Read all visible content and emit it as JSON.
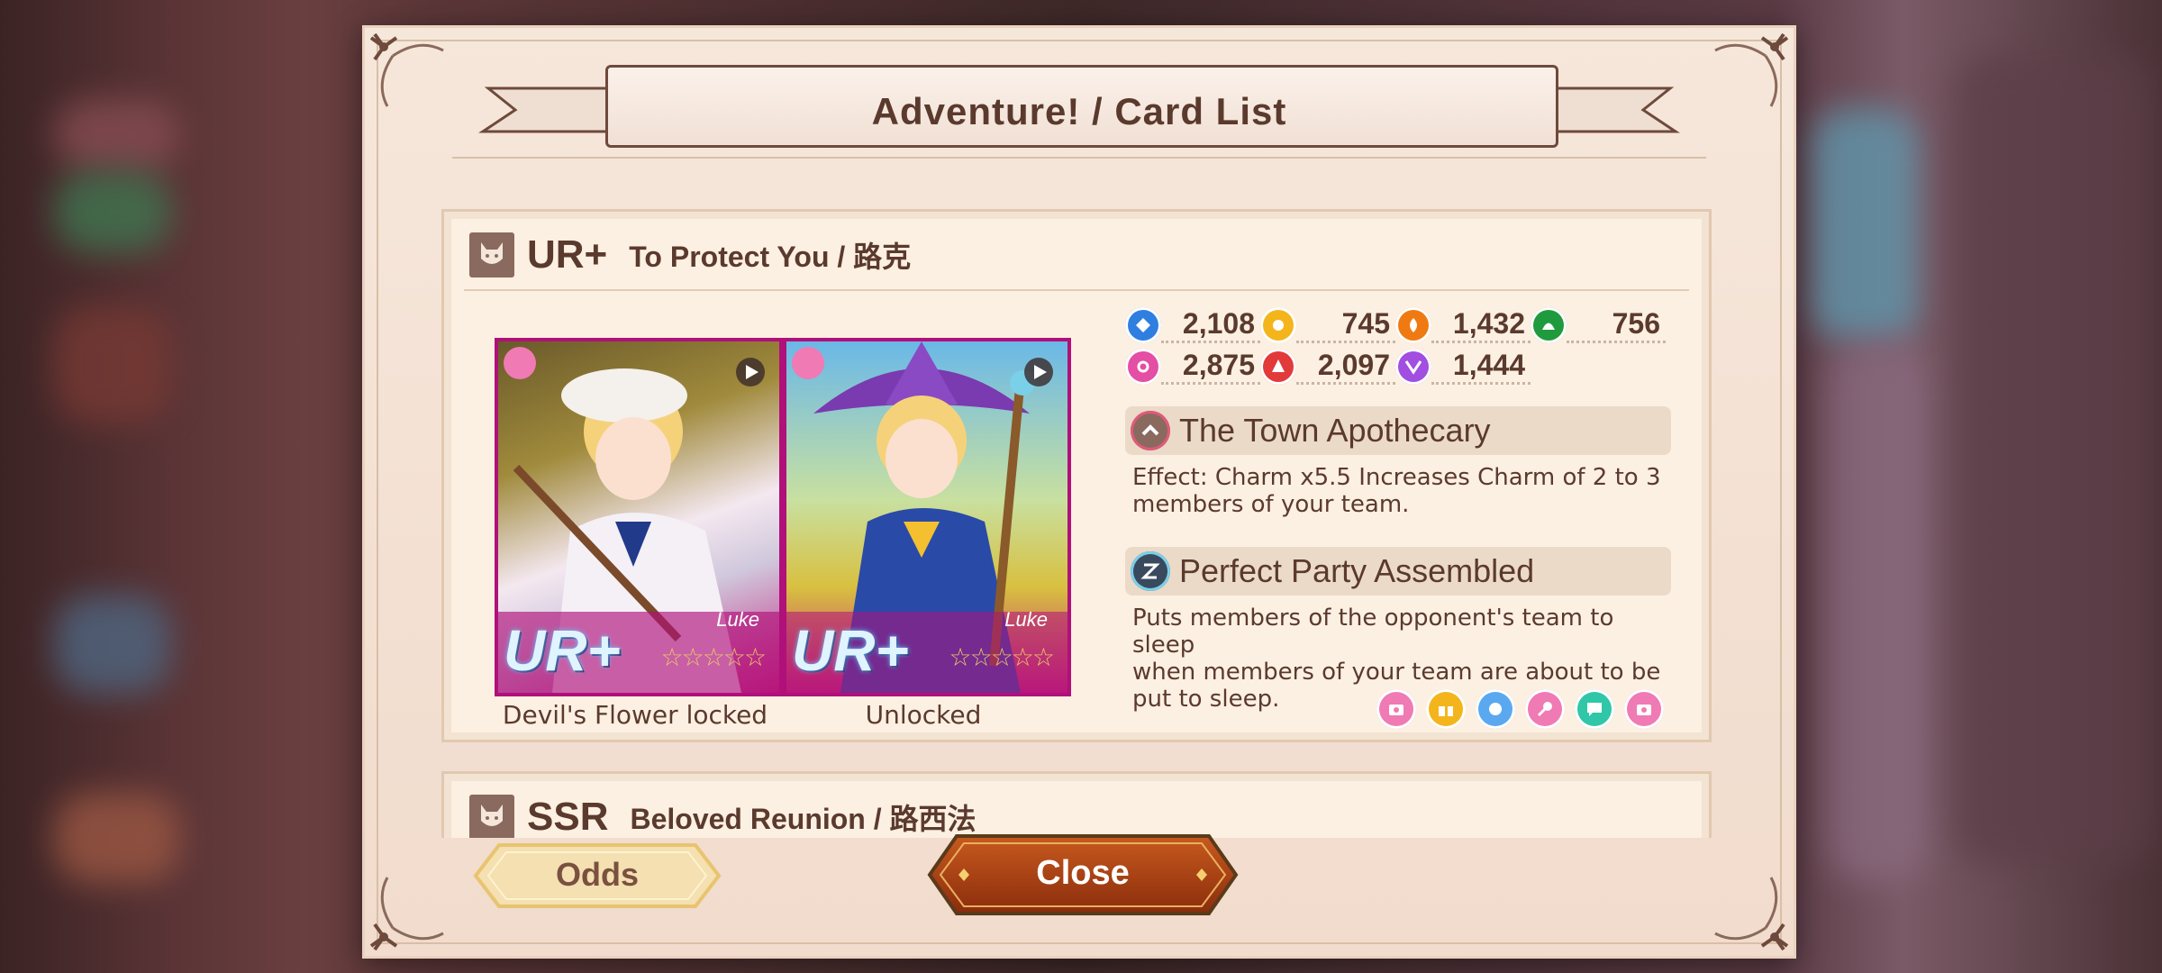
{
  "dialog": {
    "title": "Adventure! / Card List"
  },
  "cards": [
    {
      "rarity": "UR+",
      "name": "To Protect You / 路克",
      "images": [
        {
          "badge": "UR+",
          "character": "Luke",
          "caption": "Devil's Flower locked"
        },
        {
          "badge": "UR+",
          "character": "Luke",
          "caption": "Unlocked"
        }
      ],
      "stats": {
        "row1": [
          {
            "icon": "blue-diamond-icon",
            "color": "#2f7fe0",
            "value": "2,108"
          },
          {
            "icon": "yellow-sun-icon",
            "color": "#f4b51c",
            "value": "745"
          },
          {
            "icon": "orange-flame-icon",
            "color": "#f07a12",
            "value": "1,432"
          },
          {
            "icon": "green-leaf-icon",
            "color": "#1f9b3e",
            "value": "756"
          }
        ],
        "row2": [
          {
            "icon": "pink-crest-icon",
            "color": "#e44ea4",
            "value": "2,875"
          },
          {
            "icon": "red-crest-icon",
            "color": "#e23a3a",
            "value": "2,097"
          },
          {
            "icon": "purple-wing-icon",
            "color": "#a24ee0",
            "value": "1,444"
          }
        ]
      },
      "skills": [
        {
          "icon": "chevron-up-icon",
          "title": "The Town Apothecary",
          "desc1": "Effect: Charm x5.5 Increases Charm of 2 to 3",
          "desc2": "members of your team."
        },
        {
          "icon": "sleep-z-icon",
          "title": "Perfect Party Assembled",
          "desc1": "Puts members of the opponent's team to sleep",
          "desc2": "when members of your team are about to be",
          "desc3": "put to sleep."
        }
      ],
      "tag_icons": [
        {
          "icon": "camera-icon",
          "color": "#f07ab4"
        },
        {
          "icon": "gift-icon",
          "color": "#f4b51c"
        },
        {
          "icon": "face-icon",
          "color": "#5aa8f0"
        },
        {
          "icon": "microphone-icon",
          "color": "#f07ab4"
        },
        {
          "icon": "chat-icon",
          "color": "#2fc7a8"
        },
        {
          "icon": "camera-icon",
          "color": "#f07ab4"
        }
      ]
    },
    {
      "rarity": "SSR",
      "name": "Beloved Reunion / 路西法"
    }
  ],
  "buttons": {
    "odds": "Odds",
    "close": "Close"
  }
}
